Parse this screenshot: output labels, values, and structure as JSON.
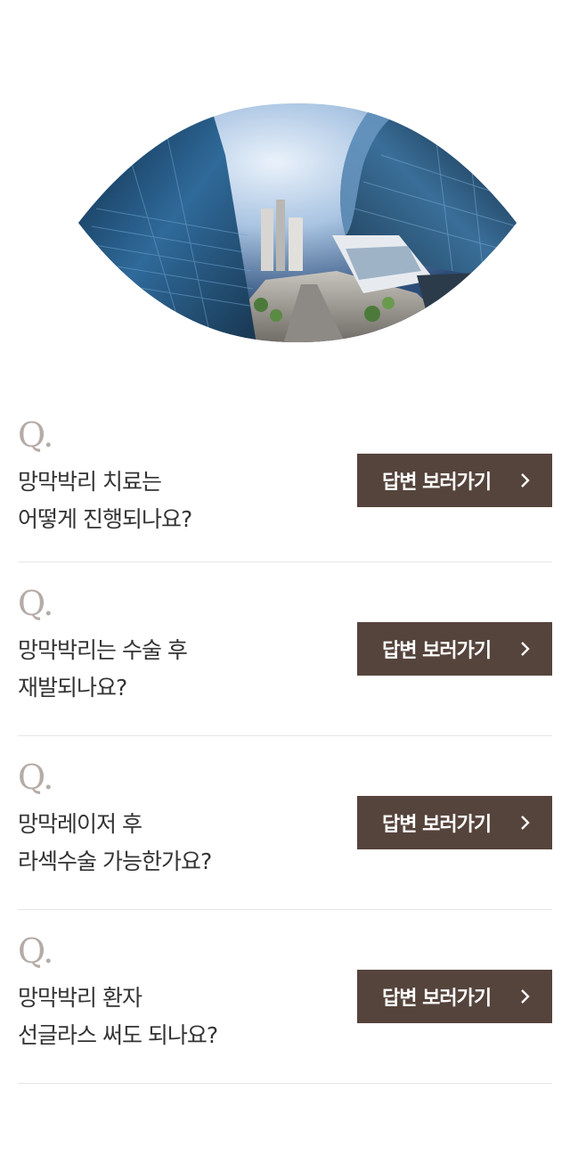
{
  "hero": {
    "image": "city-fisheye-photo"
  },
  "faq": {
    "q_symbol": "Q.",
    "button_icon": "chevron-right-icon",
    "items": [
      {
        "line1": "망막박리 치료는",
        "line2": "어떻게 진행되나요?",
        "button_label": "답변 보러가기"
      },
      {
        "line1": "망막박리는 수술 후",
        "line2": "재발되나요?",
        "button_label": "답변 보러가기"
      },
      {
        "line1": "망막레이저 후",
        "line2": "라섹수술 가능한가요?",
        "button_label": "답변 보러가기"
      },
      {
        "line1": "망막박리 환자",
        "line2": "선글라스 써도 되나요?",
        "button_label": "답변 보러가기"
      }
    ]
  },
  "colors": {
    "button_bg": "#55443c",
    "q_mark": "#b5aca7",
    "divider": "#e6e6e6"
  }
}
